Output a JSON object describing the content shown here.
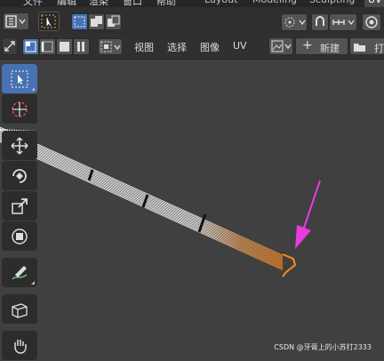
{
  "menubar": {
    "items": [
      "文件",
      "编辑",
      "渲染",
      "窗口",
      "帮助"
    ],
    "workspaces": [
      "Layout",
      "Modeling",
      "Sculpting",
      "UV"
    ],
    "active_workspace": "UV"
  },
  "header2": {
    "menus": [
      "视图",
      "选择",
      "图像",
      "UV"
    ],
    "new_button": "新建",
    "open_button": "打"
  },
  "toolbar": {
    "tools": [
      "select-box",
      "cursor",
      "move",
      "rotate",
      "scale",
      "transform",
      "annotate",
      "rip-region",
      "grab"
    ],
    "active": "select-box"
  },
  "watermark": "CSDN @牙膏上的小苏打2333",
  "colors": {
    "accent": "#4772b3",
    "uv_selected": "#ff8a1c",
    "arrow": "#e83be0"
  }
}
